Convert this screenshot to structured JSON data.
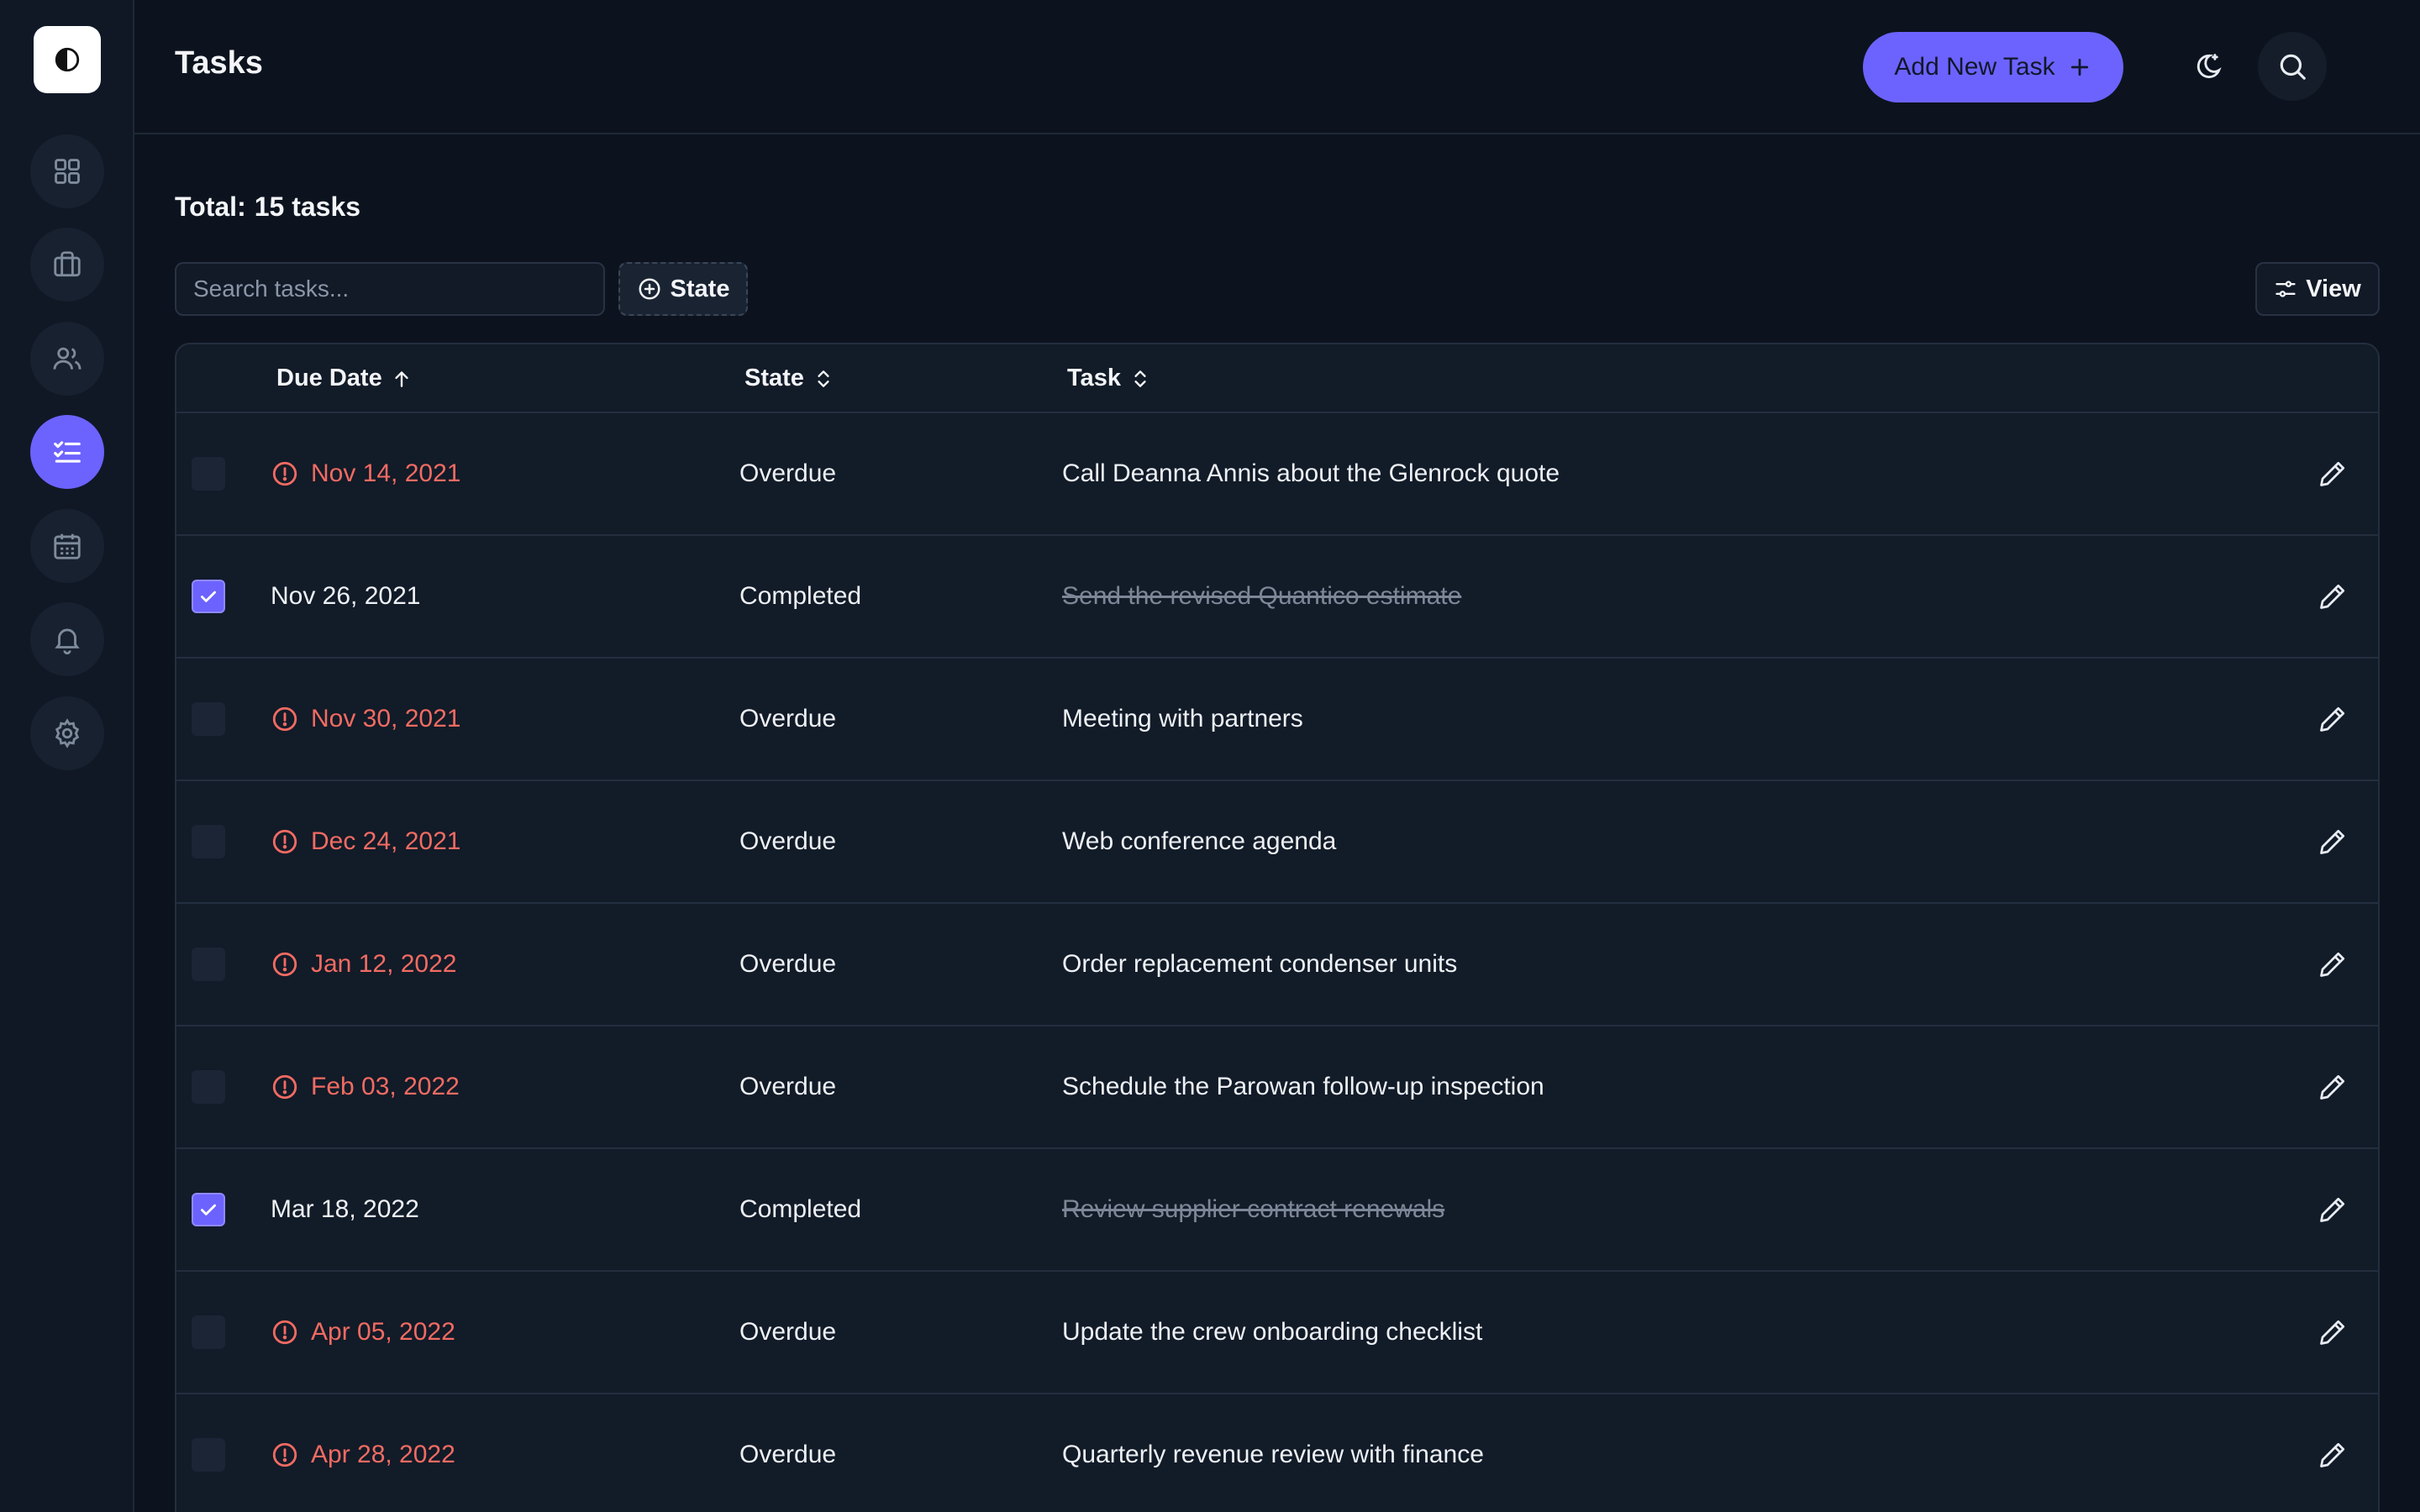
{
  "header": {
    "title": "Tasks",
    "add_button_label": "Add New Task"
  },
  "summary": {
    "label": "Total:",
    "count_text": "15 tasks"
  },
  "toolbar": {
    "search_placeholder": "Search tasks...",
    "state_filter_label": "State",
    "view_label": "View"
  },
  "sidebar": {
    "items": [
      {
        "name": "dashboard",
        "icon": "grid-icon",
        "active": false
      },
      {
        "name": "projects",
        "icon": "briefcase-icon",
        "active": false
      },
      {
        "name": "contacts",
        "icon": "users-icon",
        "active": false
      },
      {
        "name": "tasks",
        "icon": "checklist-icon",
        "active": true
      },
      {
        "name": "calendar",
        "icon": "calendar-icon",
        "active": false
      },
      {
        "name": "notifications",
        "icon": "bell-icon",
        "active": false
      },
      {
        "name": "settings",
        "icon": "gear-icon",
        "active": false
      }
    ]
  },
  "table": {
    "columns": [
      "Due Date",
      "State",
      "Task"
    ],
    "rows": [
      {
        "checked": false,
        "due": "Nov 14, 2021",
        "state": "Overdue",
        "task": "Call Deanna Annis about the Glenrock quote"
      },
      {
        "checked": true,
        "due": "Nov 26, 2021",
        "state": "Completed",
        "task": "Send the revised Quantico estimate"
      },
      {
        "checked": false,
        "due": "Nov 30, 2021",
        "state": "Overdue",
        "task": "Meeting with partners"
      },
      {
        "checked": false,
        "due": "Dec 24, 2021",
        "state": "Overdue",
        "task": "Web conference agenda"
      },
      {
        "checked": false,
        "due": "Jan 12, 2022",
        "state": "Overdue",
        "task": "Order replacement condenser units"
      },
      {
        "checked": false,
        "due": "Feb 03, 2022",
        "state": "Overdue",
        "task": "Schedule the Parowan follow-up inspection"
      },
      {
        "checked": true,
        "due": "Mar 18, 2022",
        "state": "Completed",
        "task": "Review supplier contract renewals"
      },
      {
        "checked": false,
        "due": "Apr 05, 2022",
        "state": "Overdue",
        "task": "Update the crew onboarding checklist"
      },
      {
        "checked": false,
        "due": "Apr 28, 2022",
        "state": "Overdue",
        "task": "Quarterly revenue review with finance"
      }
    ]
  },
  "colors": {
    "accent": "#6c63ff",
    "overdue": "#f26b62",
    "background": "#0c131e"
  }
}
